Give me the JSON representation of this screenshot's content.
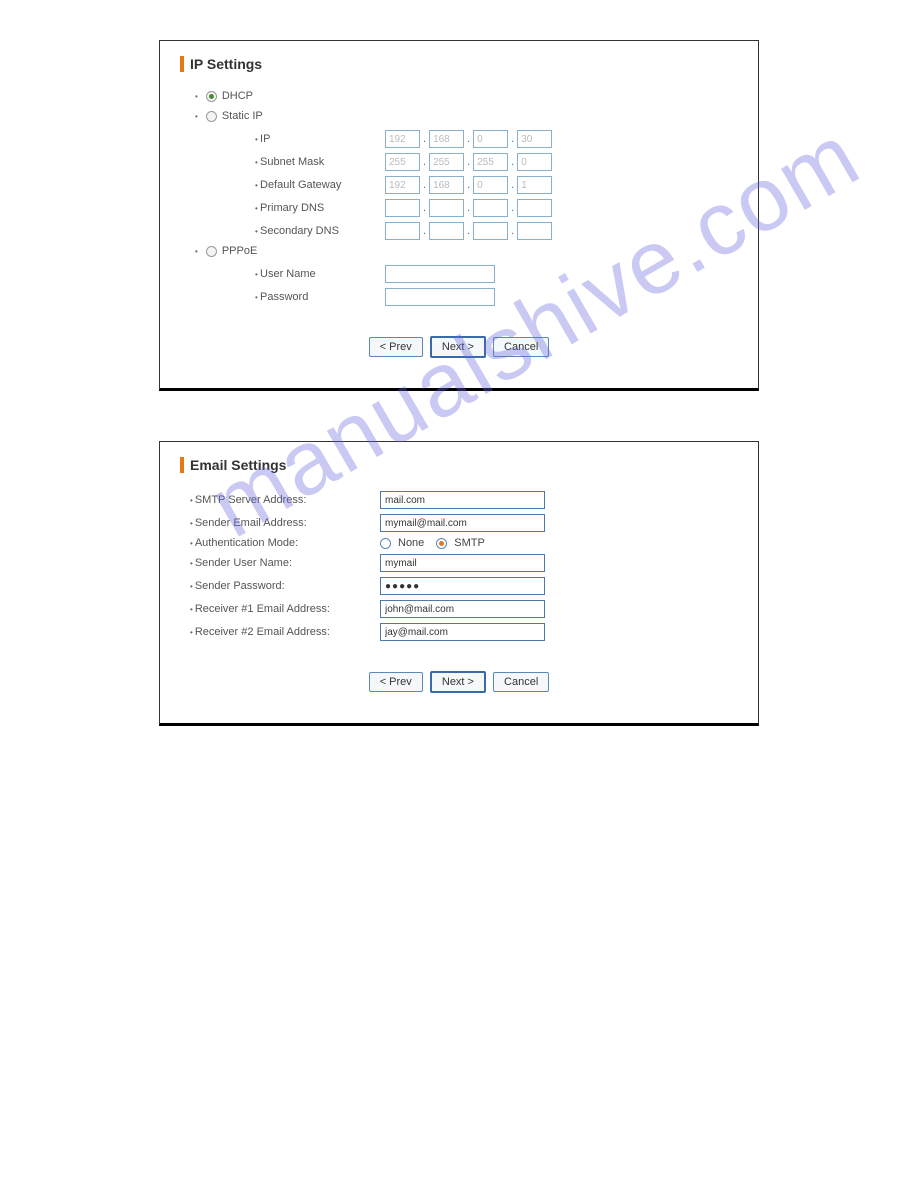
{
  "watermark": "manualshive.com",
  "ip_settings": {
    "title": "IP Settings",
    "options": {
      "dhcp": "DHCP",
      "static_ip": "Static IP",
      "pppoe": "PPPoE"
    },
    "selected_option": "dhcp",
    "fields": {
      "ip": {
        "label": "IP",
        "octets": [
          "192",
          "168",
          "0",
          "30"
        ]
      },
      "subnet_mask": {
        "label": "Subnet Mask",
        "octets": [
          "255",
          "255",
          "255",
          "0"
        ]
      },
      "default_gateway": {
        "label": "Default Gateway",
        "octets": [
          "192",
          "168",
          "0",
          "1"
        ]
      },
      "primary_dns": {
        "label": "Primary DNS",
        "octets": [
          "",
          "",
          "",
          ""
        ]
      },
      "secondary_dns": {
        "label": "Secondary DNS",
        "octets": [
          "",
          "",
          "",
          ""
        ]
      },
      "user_name": {
        "label": "User Name",
        "value": ""
      },
      "password": {
        "label": "Password",
        "value": ""
      }
    },
    "buttons": {
      "prev": "< Prev",
      "next": "Next >",
      "cancel": "Cancel"
    }
  },
  "email_settings": {
    "title": "Email Settings",
    "fields": {
      "smtp_server": {
        "label": "SMTP Server Address:",
        "value": "mail.com"
      },
      "sender_email": {
        "label": "Sender Email Address:",
        "value": "mymail@mail.com"
      },
      "auth_mode": {
        "label": "Authentication Mode:",
        "none_label": "None",
        "smtp_label": "SMTP",
        "selected": "smtp"
      },
      "sender_username": {
        "label": "Sender User Name:",
        "value": "mymail"
      },
      "sender_password": {
        "label": "Sender Password:",
        "value": "●●●●●"
      },
      "receiver1": {
        "label": "Receiver #1 Email Address:",
        "value": "john@mail.com"
      },
      "receiver2": {
        "label": "Receiver #2 Email Address:",
        "value": "jay@mail.com"
      }
    },
    "buttons": {
      "prev": "< Prev",
      "next": "Next >",
      "cancel": "Cancel"
    }
  }
}
